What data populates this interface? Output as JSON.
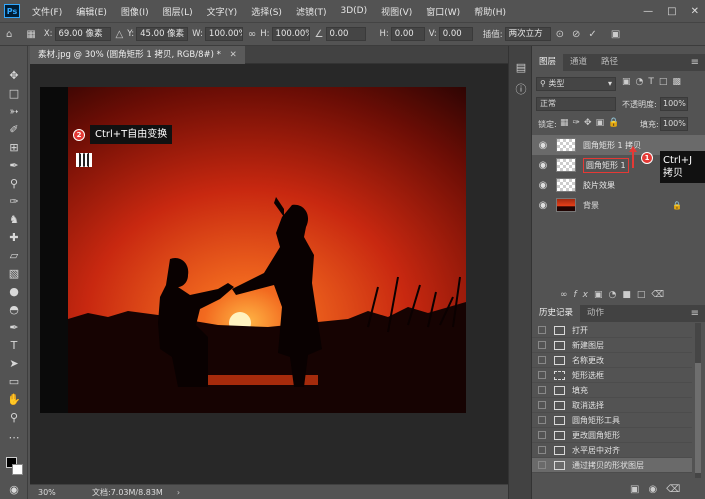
{
  "menu": {
    "logo": "Ps",
    "items": [
      "文件(F)",
      "编辑(E)",
      "图像(I)",
      "图层(L)",
      "文字(Y)",
      "选择(S)",
      "滤镜(T)",
      "3D(D)",
      "视图(V)",
      "窗口(W)",
      "帮助(H)"
    ]
  },
  "options": {
    "x_label": "X:",
    "x_value": "69.00 像素",
    "y_label": "Y:",
    "y_value": "45.00 像素",
    "w_label": "W:",
    "w_value": "100.00%",
    "h_label": "H:",
    "h_value": "100.00%",
    "angle_value": "0.00",
    "hskew_label": "H:",
    "hskew_value": "0.00",
    "vskew_label": "V:",
    "vskew_value": "0.00",
    "interp_label": "插值:",
    "interp_value": "两次立方"
  },
  "document": {
    "tab_title": "素材.jpg @ 30% (圆角矩形 1 拷贝, RGB/8#) *",
    "zoom": "30%",
    "doc_info": "文档:7.03M/8.83M"
  },
  "layers_panel": {
    "tabs": [
      "图层",
      "通道",
      "路径"
    ],
    "kind_filter": "类型",
    "blend_mode": "正常",
    "opacity_label": "不透明度:",
    "opacity_value": "100%",
    "lock_label": "锁定:",
    "fill_label": "填充:",
    "fill_value": "100%",
    "layers": [
      {
        "name": "圆角矩形 1 拷贝"
      },
      {
        "name": "圆角矩形 1"
      },
      {
        "name": "胶片效果"
      },
      {
        "name": "背景"
      }
    ]
  },
  "history_panel": {
    "tabs": [
      "历史记录",
      "动作"
    ],
    "items": [
      "打开",
      "新建图层",
      "名称更改",
      "矩形选框",
      "填充",
      "取消选择",
      "圆角矩形工具",
      "更改圆角矩形",
      "水平居中对齐",
      "通过拷贝的形状图层"
    ]
  },
  "annotations": {
    "step1_num": "1",
    "step1_line1": "Ctrl+J",
    "step1_line2": "拷贝",
    "step2_num": "2",
    "step2_text": "Ctrl+T自由变换"
  },
  "colors": {
    "accent_red": "#e53935",
    "sunset_orange": "#e8401a",
    "panel_bg": "#535353"
  }
}
